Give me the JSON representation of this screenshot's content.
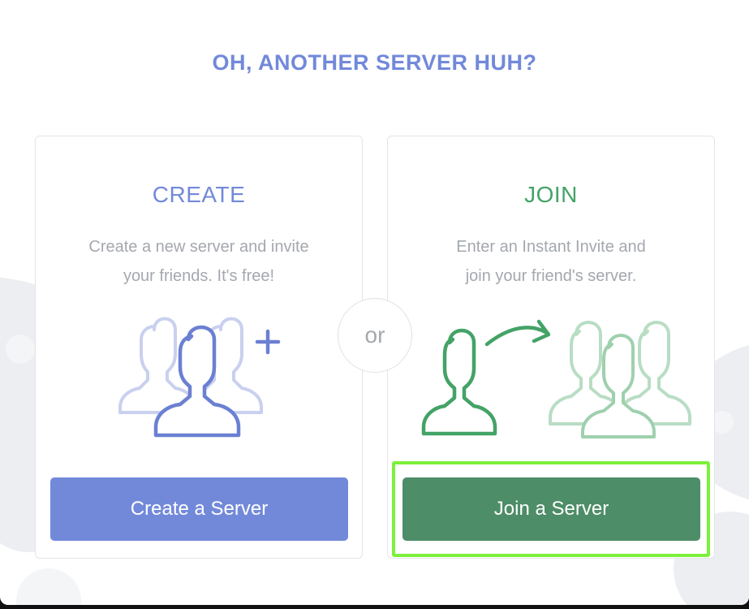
{
  "headline": "OH, ANOTHER SERVER HUH?",
  "separator": "or",
  "create": {
    "title": "CREATE",
    "description_lines": [
      "Create a new server and invite",
      "your friends. It's free!"
    ],
    "button_label": "Create a Server",
    "icon": "users-plus-icon"
  },
  "join": {
    "title": "JOIN",
    "description_lines": [
      "Enter an Instant Invite and",
      "join your friend's server."
    ],
    "button_label": "Join a Server",
    "icon": "user-join-group-icon",
    "highlighted": true
  },
  "colors": {
    "headline": "#7289da",
    "create_title": "#7289da",
    "create_button": "#7289da",
    "join_title": "#43a367",
    "join_button": "#4d8d67",
    "highlight": "#7cf03a",
    "description": "#a4a8ae"
  }
}
